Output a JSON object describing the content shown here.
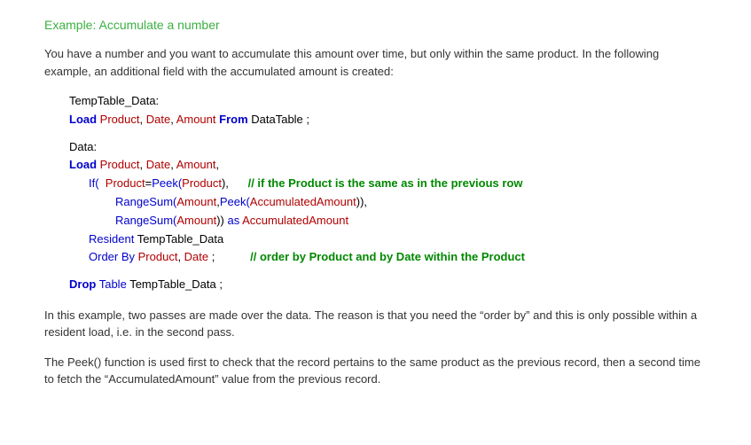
{
  "heading": "Example: Accumulate a number",
  "para1": "You have a number and you want to accumulate this amount over time, but only within the same product. In the following example, an additional field with the accumulated amount is created:",
  "code": {
    "l1a": "TempTable_Data:",
    "l2_load": "Load",
    "l2_product": " Product",
    "l2_c1": ", ",
    "l2_date": "Date",
    "l2_c2": ", ",
    "l2_amount": "Amount",
    "l2_from": " From ",
    "l2_table": "DataTable ;",
    "l3a": "Data:",
    "l4_load": "Load",
    "l4_product": " Product",
    "l4_c1": ", ",
    "l4_date": "Date",
    "l4_c2": ", ",
    "l4_amount": "Amount",
    "l4_c3": ",",
    "l5_if": "If(",
    "l5_prod": "  Product",
    "l5_eq": "=",
    "l5_peek": "Peek(",
    "l5_prod2": "Product",
    "l5_close": "),      ",
    "l5_comment": "// if the Product is the same as in the previous row",
    "l6_range": "RangeSum(",
    "l6_amount": "Amount",
    "l6_c": ",",
    "l6_peek": "Peek(",
    "l6_acc": "AccumulatedAmount",
    "l6_close": ")),",
    "l7_range": "RangeSum(",
    "l7_amount": "Amount",
    "l7_close": ")) ",
    "l7_as": "as",
    "l7_acc": " AccumulatedAmount",
    "l8_res": "Resident",
    "l8_tbl": " TempTable_Data",
    "l9_ord": "Order By",
    "l9_prod": " Product",
    "l9_c": ", ",
    "l9_date": "Date",
    "l9_semi": " ;           ",
    "l9_comment": "// order by Product and by Date within the Product",
    "l10_drop": "Drop",
    "l10_table": " Table",
    "l10_name": " TempTable_Data ;"
  },
  "para2": "In this example, two passes are made over the data. The reason is that you need the “order by” and this is only possible within a resident load, i.e. in the second pass.",
  "para3": "The Peek() function is used first to check that the record pertains to the same product as the previous record, then a second time to fetch the “AccumulatedAmount” value from the previous record."
}
